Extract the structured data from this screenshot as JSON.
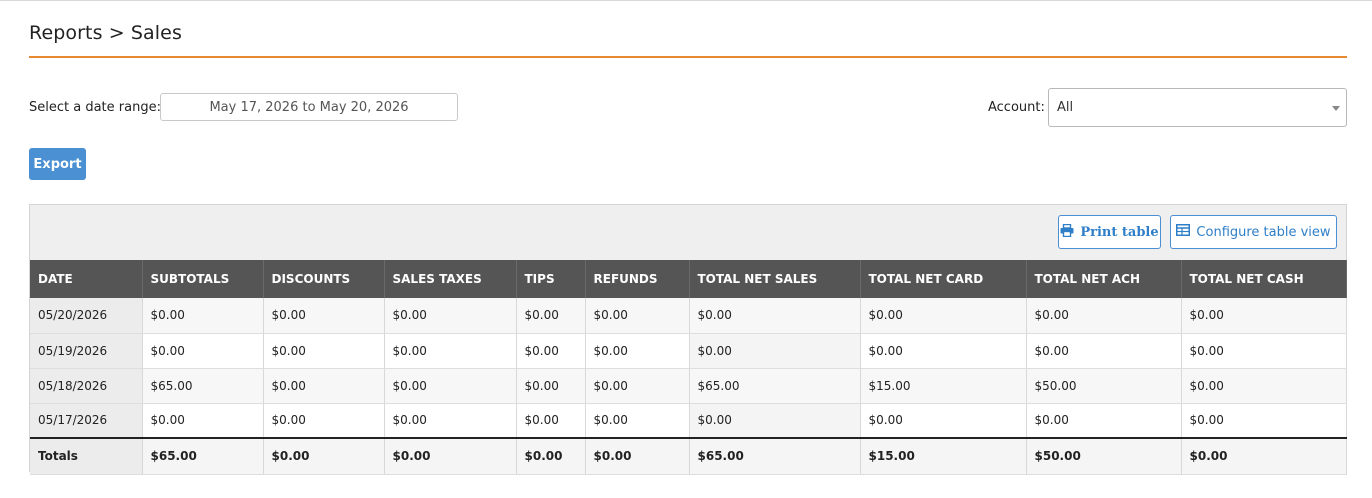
{
  "header": {
    "title": "Reports > Sales"
  },
  "filters": {
    "date_label": "Select a date range:",
    "date_value": "May 17, 2026 to May 20, 2026",
    "account_label": "Account:",
    "account_value": "All"
  },
  "actions": {
    "export_label": "Export"
  },
  "toolbar": {
    "print_label": "Print table",
    "configure_label": "Configure table view"
  },
  "table": {
    "columns": [
      "DATE",
      "SUBTOTALS",
      "DISCOUNTS",
      "SALES TAXES",
      "TIPS",
      "REFUNDS",
      "TOTAL NET SALES",
      "TOTAL NET CARD",
      "TOTAL NET ACH",
      "TOTAL NET CASH"
    ],
    "rows": [
      [
        "05/20/2026",
        "$0.00",
        "$0.00",
        "$0.00",
        "$0.00",
        "$0.00",
        "$0.00",
        "$0.00",
        "$0.00",
        "$0.00"
      ],
      [
        "05/19/2026",
        "$0.00",
        "$0.00",
        "$0.00",
        "$0.00",
        "$0.00",
        "$0.00",
        "$0.00",
        "$0.00",
        "$0.00"
      ],
      [
        "05/18/2026",
        "$65.00",
        "$0.00",
        "$0.00",
        "$0.00",
        "$0.00",
        "$65.00",
        "$15.00",
        "$50.00",
        "$0.00"
      ],
      [
        "05/17/2026",
        "$0.00",
        "$0.00",
        "$0.00",
        "$0.00",
        "$0.00",
        "$0.00",
        "$0.00",
        "$0.00",
        "$0.00"
      ]
    ],
    "totals": [
      "Totals",
      "$65.00",
      "$0.00",
      "$0.00",
      "$0.00",
      "$0.00",
      "$65.00",
      "$15.00",
      "$50.00",
      "$0.00"
    ]
  },
  "icons": {
    "print": "printer-icon",
    "configure": "table-icon",
    "dropdown": "chevron-down-icon"
  },
  "colors": {
    "accent": "#e8892f",
    "primary": "#4a90d2",
    "header_bg": "#555555"
  }
}
